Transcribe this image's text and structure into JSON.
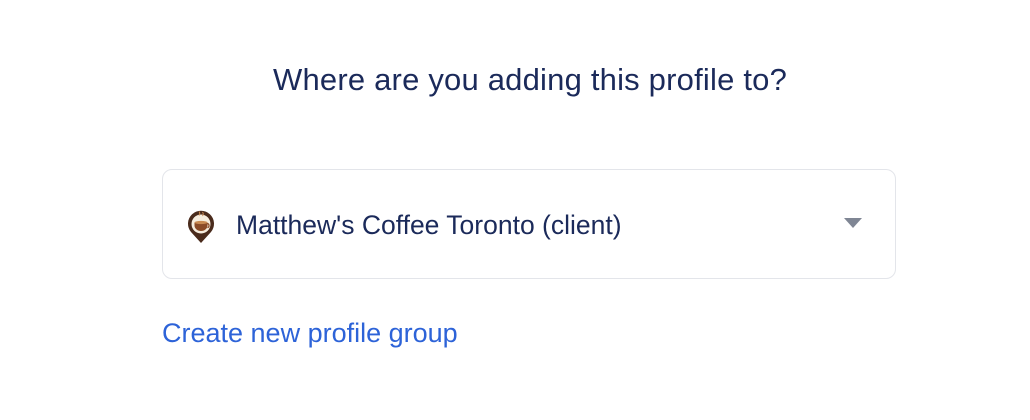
{
  "heading": "Where are you adding this profile to?",
  "profile_group_select": {
    "selected_label": "Matthew's Coffee Toronto (client)",
    "avatar_icon": "coffee-cup-location-pin-icon",
    "chevron_icon": "chevron-down-icon"
  },
  "create_link_label": "Create new profile group",
  "colors": {
    "heading": "#1b2a5a",
    "link": "#2d63d8",
    "border": "#e3e5ea",
    "chevron": "#7f8694"
  }
}
